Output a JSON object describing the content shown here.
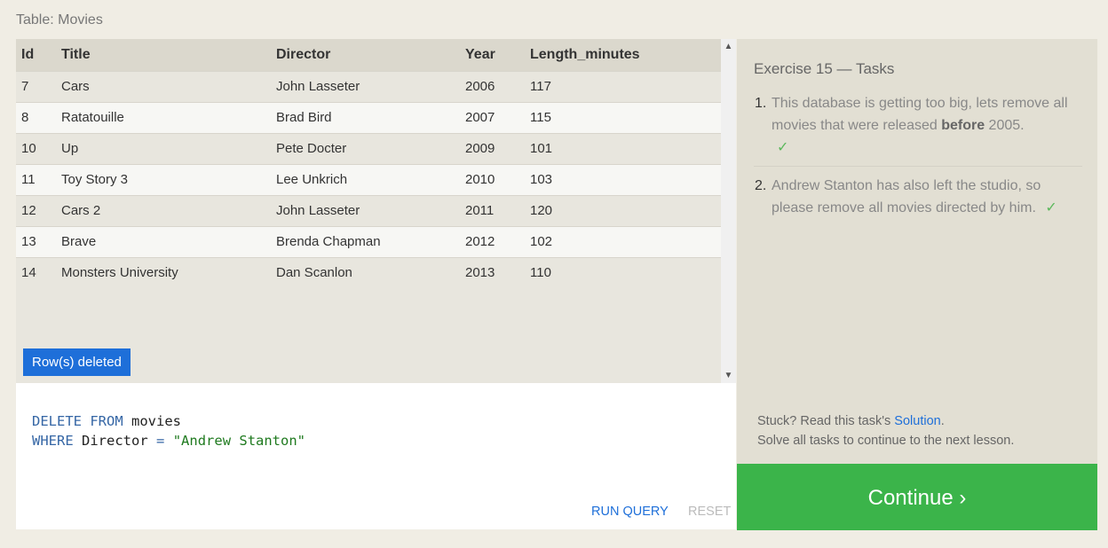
{
  "table_caption": "Table: Movies",
  "columns": [
    "Id",
    "Title",
    "Director",
    "Year",
    "Length_minutes"
  ],
  "rows": [
    [
      "7",
      "Cars",
      "John Lasseter",
      "2006",
      "117"
    ],
    [
      "8",
      "Ratatouille",
      "Brad Bird",
      "2007",
      "115"
    ],
    [
      "10",
      "Up",
      "Pete Docter",
      "2009",
      "101"
    ],
    [
      "11",
      "Toy Story 3",
      "Lee Unkrich",
      "2010",
      "103"
    ],
    [
      "12",
      "Cars 2",
      "John Lasseter",
      "2011",
      "120"
    ],
    [
      "13",
      "Brave",
      "Brenda Chapman",
      "2012",
      "102"
    ],
    [
      "14",
      "Monsters University",
      "Dan Scanlon",
      "2013",
      "110"
    ]
  ],
  "status_badge": "Row(s) deleted",
  "scroll_up_icon": "▲",
  "scroll_down_icon": "▼",
  "query": {
    "line1_kw": "DELETE FROM",
    "line1_ident": "movies",
    "line2_kw": "WHERE",
    "line2_ident": "Director",
    "line2_op": "=",
    "line2_str": "\"Andrew Stanton\""
  },
  "buttons": {
    "run": "RUN QUERY",
    "reset": "RESET"
  },
  "tasks": {
    "title": "Exercise 15 — Tasks",
    "items": [
      {
        "num": "1.",
        "text_before": "This database is getting too big, lets remove all movies that were released ",
        "bold": "before",
        "text_after": " 2005.",
        "check": "✓"
      },
      {
        "num": "2.",
        "text": "Andrew Stanton has also left the studio, so please remove all movies directed by him.",
        "check": "✓"
      }
    ],
    "hint_prefix": "Stuck? Read this task's ",
    "hint_link": "Solution",
    "hint_suffix": ".",
    "hint_line2": "Solve all tasks to continue to the next lesson."
  },
  "continue_label": "Continue ›",
  "colors": {
    "accent_blue": "#1e6fd9",
    "continue_green": "#3bb44a",
    "check_green": "#5cb85c"
  }
}
